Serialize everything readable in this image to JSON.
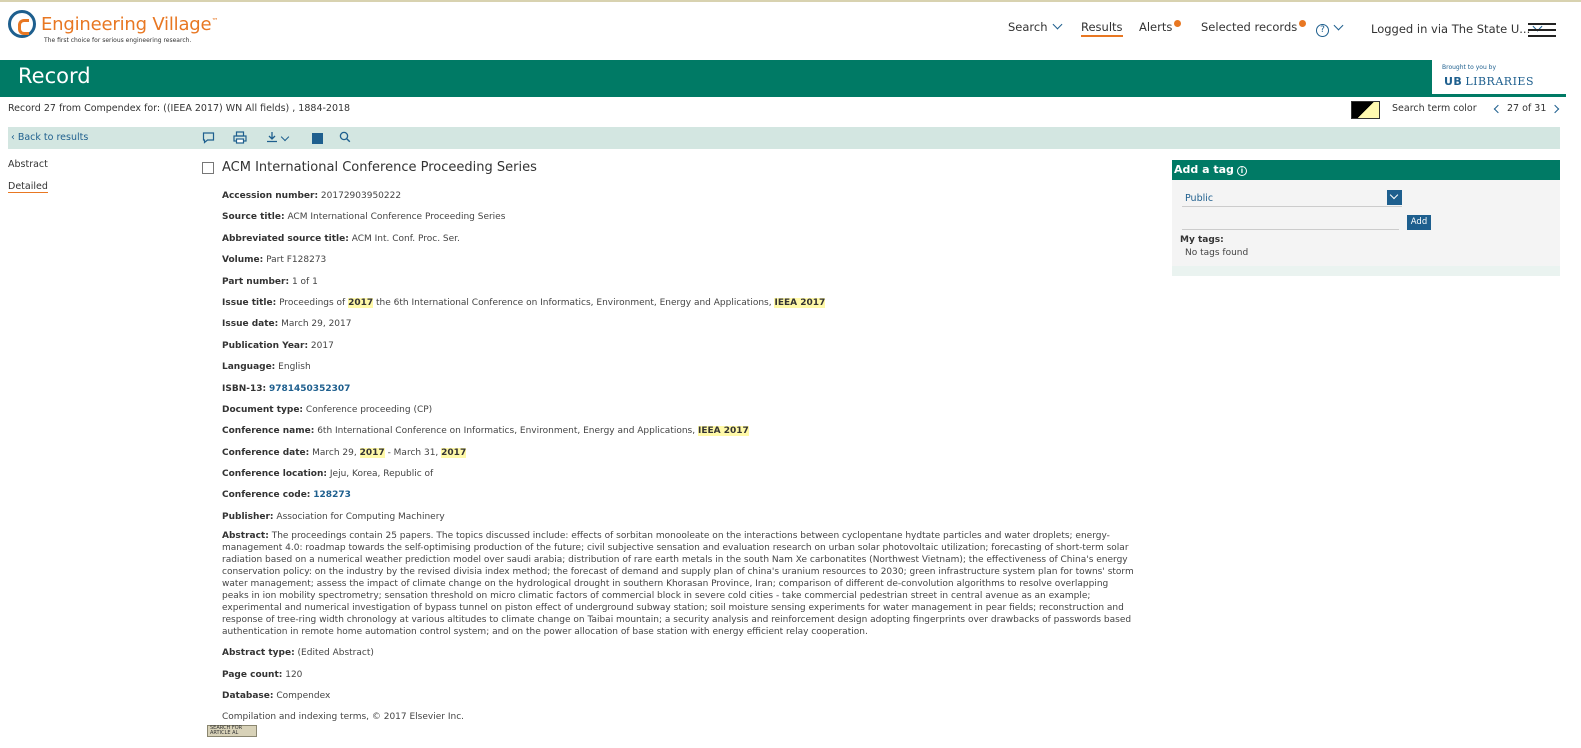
{
  "header": {
    "app_title": "Engineering Village",
    "trademark": "™",
    "tagline": "The first choice for serious engineering research.",
    "nav": {
      "search": "Search",
      "results": "Results",
      "alerts": "Alerts",
      "selected_records": "Selected records",
      "help": "?",
      "login": "Logged in via The State U..."
    }
  },
  "page": {
    "title": "Record",
    "brought_by": "Brought to you by",
    "library_mark": "UB",
    "library_name": "LIBRARIES",
    "record_info": "Record 27 from Compendex for: ((IEEA 2017) WN All fields) , 1884-2018",
    "search_term_color_label": "Search term color",
    "pager": "27 of 31"
  },
  "toolbar": {
    "back": "Back to results",
    "icons": [
      "comment-icon",
      "print-icon",
      "download-icon",
      "save-icon",
      "search-icon"
    ]
  },
  "leftnav": {
    "abstract": "Abstract",
    "detailed": "Detailed"
  },
  "record": {
    "title": "ACM International Conference Proceeding Series",
    "accession_label": "Accession number:",
    "accession": "20172903950222",
    "source_label": "Source title:",
    "source": "ACM International Conference Proceeding Series",
    "abbrev_label": "Abbreviated source title:",
    "abbrev": "ACM Int. Conf. Proc. Ser.",
    "volume_label": "Volume:",
    "volume": "Part F128273",
    "part_label": "Part number:",
    "part": "1 of 1",
    "issue_title_label": "Issue title:",
    "issue_title_a": "Proceedings of",
    "issue_title_hl1": "2017",
    "issue_title_b": "the 6th International Conference on Informatics, Environment, Energy and Applications,",
    "issue_title_hl2": "IEEA 2017",
    "issue_date_label": "Issue date:",
    "issue_date": "March 29, 2017",
    "pub_year_label": "Publication Year:",
    "pub_year": "2017",
    "language_label": "Language:",
    "language": "English",
    "isbn_label": "ISBN-13:",
    "isbn": "9781450352307",
    "doctype_label": "Document type:",
    "doctype": "Conference proceeding (CP)",
    "confname_label": "Conference name:",
    "confname": "6th International Conference on Informatics, Environment, Energy and Applications,",
    "confname_hl": "IEEA 2017",
    "confdate_label": "Conference date:",
    "confdate_a": "March 29,",
    "confdate_hl1": "2017",
    "confdate_b": "- March 31,",
    "confdate_hl2": "2017",
    "conflocation_label": "Conference location:",
    "conflocation": "Jeju, Korea, Republic of",
    "confcode_label": "Conference code:",
    "confcode": "128273",
    "publisher_label": "Publisher:",
    "publisher": "Association for Computing Machinery",
    "abstract_label": "Abstract:",
    "abstract": "The proceedings contain 25 papers. The topics discussed include: effects of sorbitan monooleate on the interactions between cyclopentane hydtate particles and water droplets; energy-management 4.0: roadmap towards the self-optimising production of the future; civil subjective sensation and evaluation research on urban solar photovoltaic utilization; forecasting of short-term solar radiation based on a numerical weather prediction model over saudi arabia; distribution of rare earth metals in the south Nam Xe carbonatites (Northwest Vietnam); the effectiveness of China's energy conservation policy: on the industry by the revised divisia index method; the forecast of demand and supply plan of china's uranium resources to 2030; green infrastructure system plan for towns' storm water management; assess the impact of climate change on the hydrological drought in southern Khorasan Province, Iran; comparison of different de-convolution algorithms to resolve overlapping peaks in ion mobility spectrometry; sensation threshold on micro climatic factors of commercial block in severe cold cities - take commercial pedestrian street in central avenue as an example; experimental and numerical investigation of bypass tunnel on piston effect of underground subway station; soil moisture sensing experiments for water management in pear fields; reconstruction and response of tree-ring width chronology at various altitudes to climate change on Taibai mountain; a security analysis and reinforcement design adopting fingerprints over drawbacks of passwords based authentication in remote home automation control system; and on the power allocation of base station with energy efficient relay cooperation.",
    "abstract_type_label": "Abstract type:",
    "abstract_type": "(Edited Abstract)",
    "page_count_label": "Page count:",
    "page_count": "120",
    "database_label": "Database:",
    "database": "Compendex",
    "copyright": "Compilation and indexing terms, © 2017 Elsevier Inc.",
    "sfx_line1": "SEARCH FOR",
    "sfx_line2": "ARTICLE AL"
  },
  "tags": {
    "header": "Add a tag",
    "info": "i",
    "visibility": "Public",
    "add_button": "Add",
    "my_tags": "My tags:",
    "no_tags": "No tags found"
  },
  "colors": {
    "brand_green": "#007a65",
    "brand_orange": "#e87722",
    "link_blue": "#1e5f8e",
    "highlight": "#fff9a8"
  }
}
